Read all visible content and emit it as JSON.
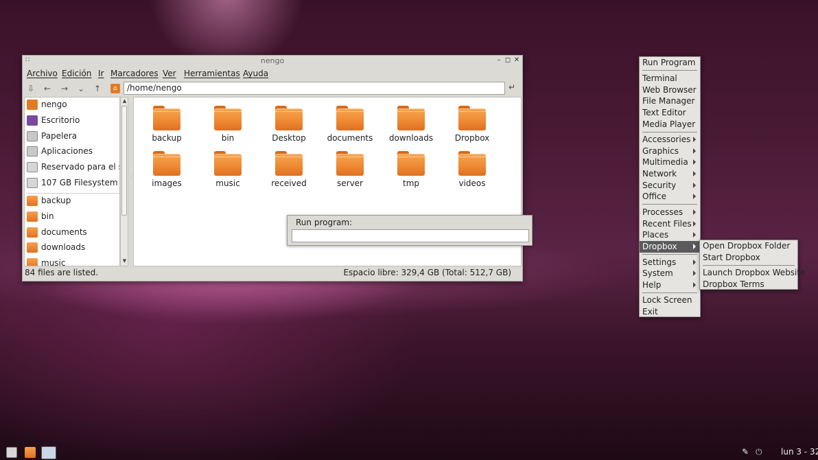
{
  "window": {
    "title": "nengo",
    "menu": [
      "Archivo",
      "Edición",
      "Ir",
      "Marcadores",
      "Ver",
      "Herramientas",
      "Ayuda"
    ],
    "path": "/home/nengo",
    "sidebar": [
      "nengo",
      "Escritorio",
      "Papelera",
      "Aplicaciones",
      "Reservado para el sistema",
      "107 GB Filesystem",
      "backup",
      "bin",
      "documents",
      "downloads",
      "music"
    ],
    "files": [
      "backup",
      "bin",
      "Desktop",
      "documents",
      "downloads",
      "Dropbox",
      "images",
      "music",
      "received",
      "server",
      "tmp",
      "videos"
    ],
    "status_left": "84 files are listed.",
    "status_right": "Espacio libre: 329,4 GB (Total: 512,7 GB)"
  },
  "run_dialog": {
    "label": "Run program:",
    "value": ""
  },
  "root_menu": {
    "items": [
      "Run Program",
      "Terminal",
      "Web Browser",
      "File Manager",
      "Text Editor",
      "Media Player",
      "Accessories",
      "Graphics",
      "Multimedia",
      "Network",
      "Security",
      "Office",
      "Processes",
      "Recent Files",
      "Places",
      "Dropbox",
      "Settings",
      "System",
      "Help",
      "Lock Screen",
      "Exit"
    ],
    "selected": "Dropbox"
  },
  "dropbox_menu": {
    "items": [
      "Open Dropbox Folder",
      "Start Dropbox",
      "Launch Dropbox Website",
      "Dropbox Terms"
    ]
  },
  "taskbar": {
    "clock": "lun 3 - 32"
  },
  "icons": {
    "drag_grip": "∷",
    "minimize": "–",
    "maximize": "◻",
    "close": "✕",
    "bookmark": "⇩",
    "back": "←",
    "forward": "→",
    "history": "⌄",
    "up": "↑",
    "home": "⌂",
    "go": "↵",
    "scroll_up": "▲",
    "scroll_down": "▼",
    "tray_pen": "✎",
    "tray_power": "⏻"
  },
  "colors": {
    "folder": "#ee8a35",
    "menu_selected": "#5b5b5b"
  }
}
